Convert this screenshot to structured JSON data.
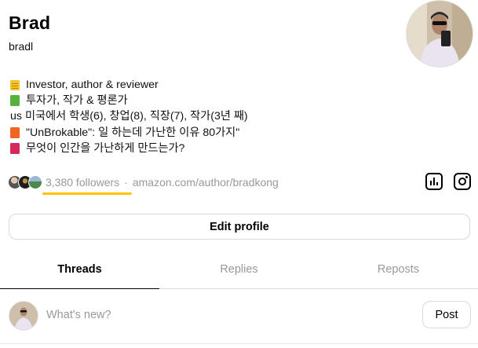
{
  "profile": {
    "display_name": "Brad",
    "username": "bradl"
  },
  "bio": [
    {
      "marker": "notepad-icon",
      "prefix": "",
      "text": "Investor, author & reviewer"
    },
    {
      "marker": "green-book-icon",
      "prefix": "",
      "text": "투자가, 작가 & 평론가"
    },
    {
      "marker": "us-flag",
      "prefix": "us",
      "text": "미국에서 학생(6), 창업(8), 직장(7), 작가(3년 째)"
    },
    {
      "marker": "orange-book-icon",
      "prefix": "",
      "text": "\"UnBrokable\": 일 하는데 가난한 이유 80가지\""
    },
    {
      "marker": "red-book-icon",
      "prefix": "",
      "text": "무엇이 인간을 가난하게 만드는가?"
    }
  ],
  "stats": {
    "followers": "3,380 followers",
    "separator": "·",
    "link": "amazon.com/author/bradkong"
  },
  "actions": {
    "edit_profile": "Edit profile"
  },
  "tabs": [
    {
      "label": "Threads",
      "active": true
    },
    {
      "label": "Replies",
      "active": false
    },
    {
      "label": "Reposts",
      "active": false
    }
  ],
  "composer": {
    "placeholder": "What's new?",
    "post_label": "Post"
  },
  "colors": {
    "accent_underline": "#ffc400",
    "muted_text": "#999999",
    "border": "#d9d9d9"
  }
}
